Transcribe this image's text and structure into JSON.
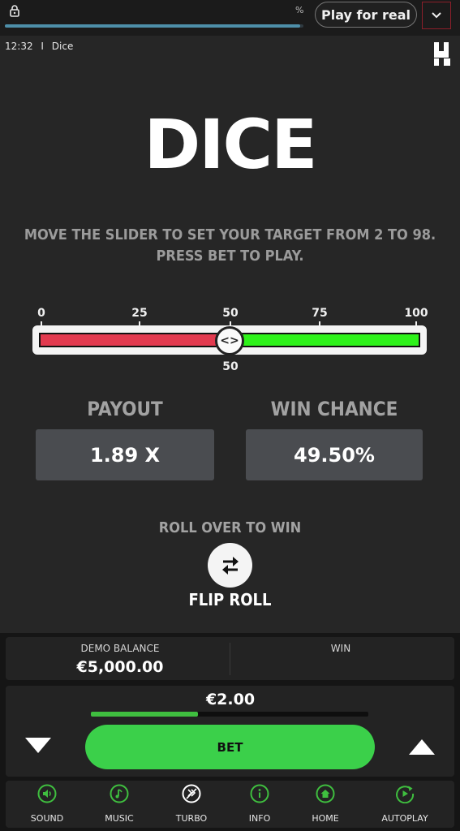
{
  "browser": {
    "percent_symbol": "%",
    "progress": 0.99,
    "play_for_real_label": "Play for real",
    "icons": {
      "lock": "lock-icon",
      "dropdown": "chevron-down-icon"
    }
  },
  "status": {
    "time": "12:32",
    "separator": "I",
    "game_name": "Dice"
  },
  "game": {
    "title": "DICE",
    "instructions_line1": "MOVE THE SLIDER TO SET YOUR TARGET FROM 2 TO 98.",
    "instructions_line2": "PRESS BET TO PLAY.",
    "slider": {
      "ticks": [
        "0",
        "25",
        "50",
        "75",
        "100"
      ],
      "value": 50,
      "value_label": "50",
      "thumb_glyph": "<>",
      "colors": {
        "lose": "#e23a4f",
        "win": "#2ef21a"
      }
    },
    "payout_label": "PAYOUT",
    "payout_value": "1.89 X",
    "win_chance_label": "WIN CHANCE",
    "win_chance_value": "49.50%",
    "roll_over_label": "ROLL OVER TO WIN",
    "flip_roll_label": "FLIP ROLL"
  },
  "balance": {
    "demo_balance_label": "DEMO BALANCE",
    "demo_balance_value": "€5,000.00",
    "win_label": "WIN"
  },
  "bet": {
    "amount": "€2.00",
    "amount_level": 0.385,
    "bet_label": "BET",
    "accent": "#3bd04a"
  },
  "nav": {
    "items": [
      {
        "label": "SOUND",
        "icon": "speaker-icon"
      },
      {
        "label": "MUSIC",
        "icon": "music-note-icon"
      },
      {
        "label": "TURBO",
        "icon": "turbo-icon"
      },
      {
        "label": "INFO",
        "icon": "info-icon"
      },
      {
        "label": "HOME",
        "icon": "home-icon"
      },
      {
        "label": "AUTOPLAY",
        "icon": "autoplay-icon"
      }
    ]
  }
}
